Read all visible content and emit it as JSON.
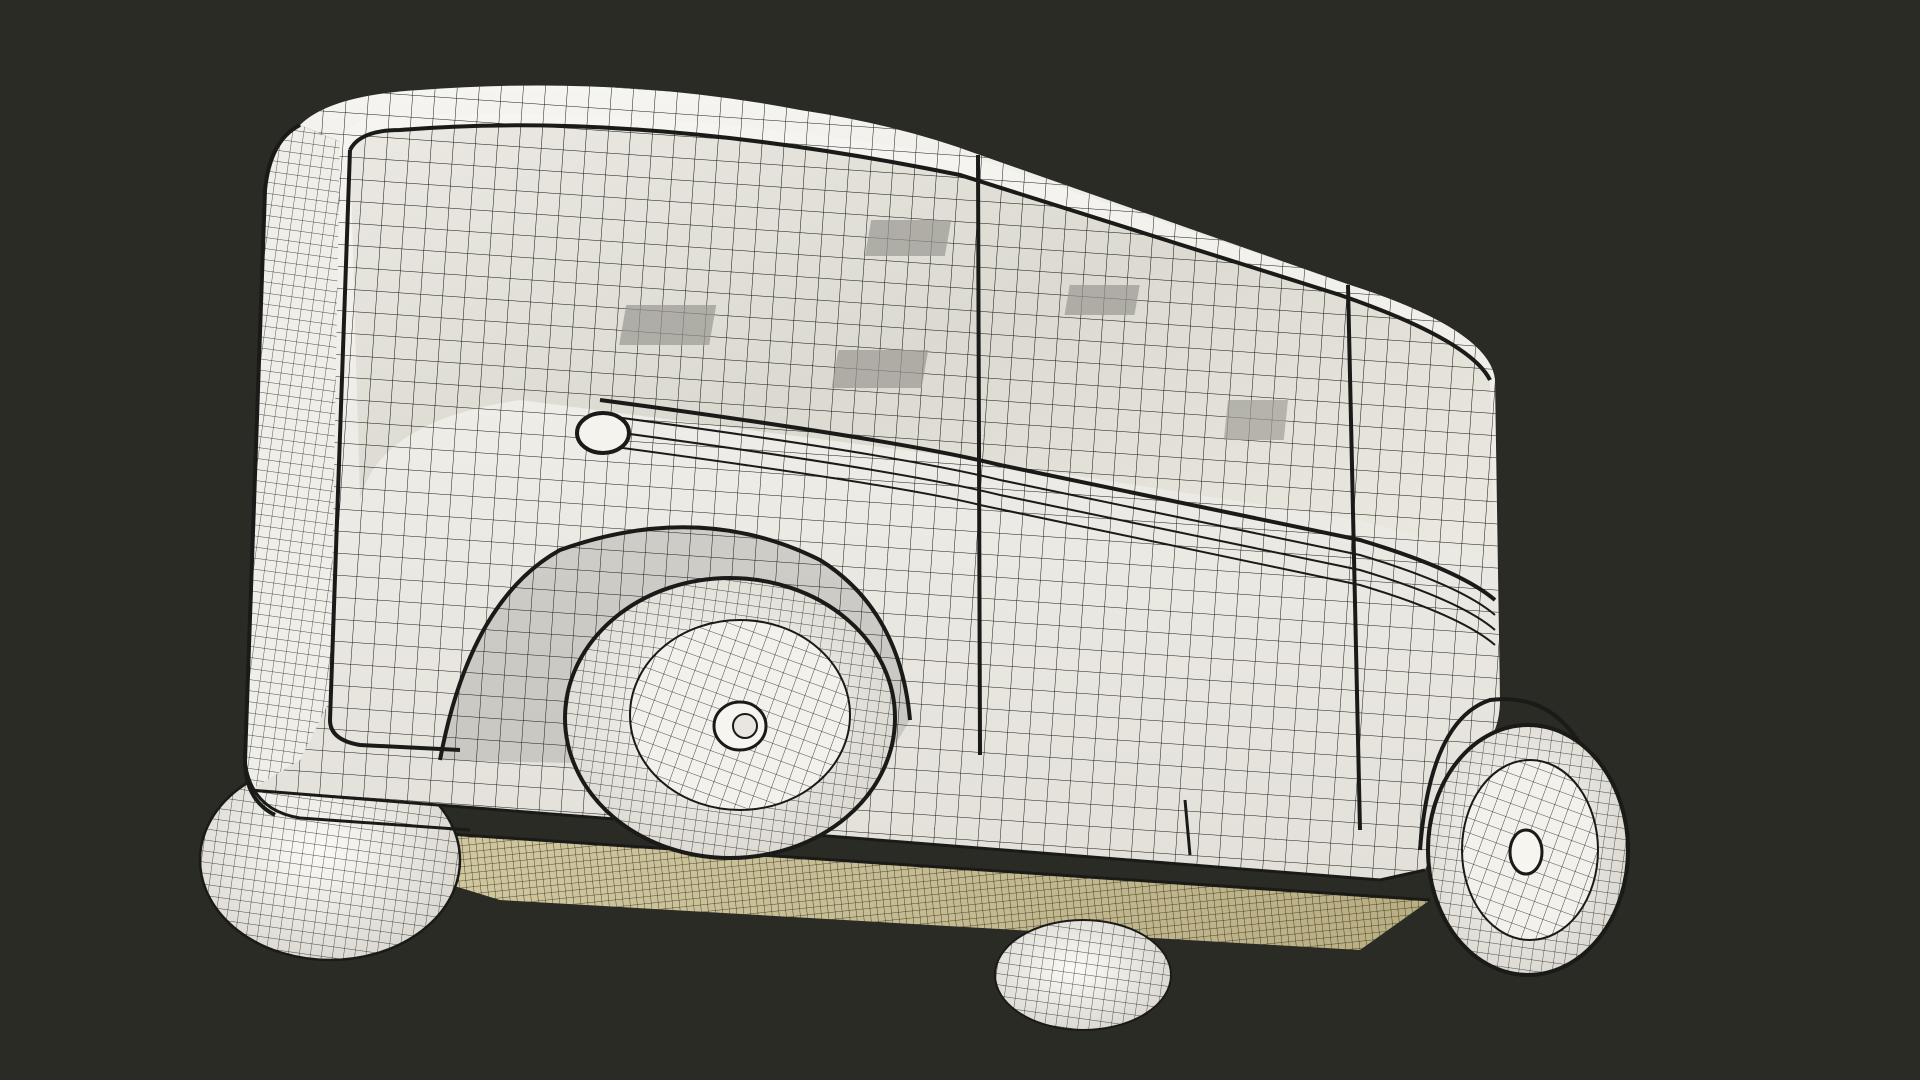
{
  "scene": {
    "subject": "wireframe-vehicle-render",
    "colors": {
      "background": "#2a2b25",
      "body": "#f2f1ec",
      "glass": "#e6e4dc",
      "wire": "#1a1a18",
      "underside": "#c9bf95",
      "interior_dark": "#8d8c86",
      "tire": "#efeee9"
    }
  }
}
